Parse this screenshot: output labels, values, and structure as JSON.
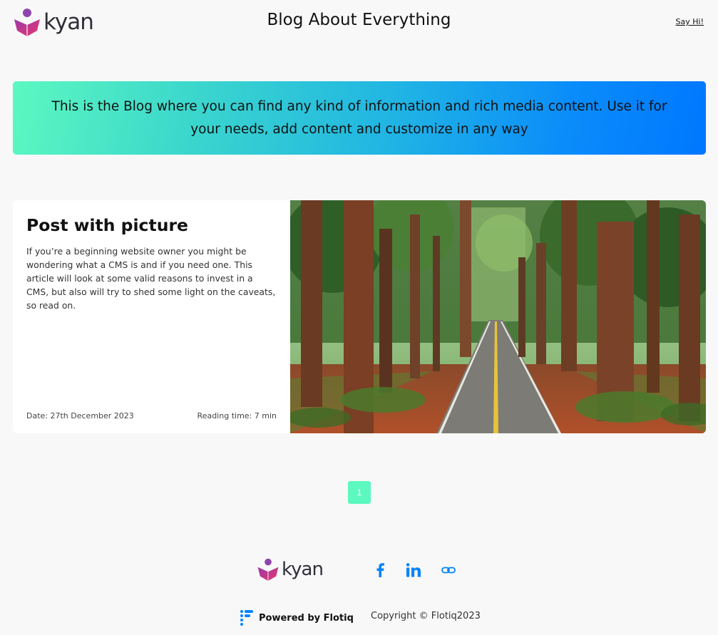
{
  "header": {
    "logo_text": "kyan",
    "site_title": "Blog About Everything",
    "say_hi_link": "Say Hi!"
  },
  "banner": {
    "text": "This is the Blog where you can find any kind of information and rich media content. Use it for your needs, add content and customize in any way"
  },
  "posts": [
    {
      "title": "Post with picture",
      "excerpt": "If you’re a beginning website owner you might be wondering what a CMS is and if you need one. This article will look at some valid reasons to invest in a CMS, but also will try to shed some light on the caveats, so read on.",
      "date": "Date: 27th December 2023",
      "reading_time": "Reading time: 7 min"
    }
  ],
  "pagination": {
    "current_page": "1"
  },
  "footer": {
    "logo_text": "kyan",
    "social_icons": [
      "facebook-icon",
      "linkedin-icon",
      "link-icon"
    ],
    "powered_by": "Powered by Flotiq",
    "copyright": "Copyright © Flotiq2023"
  },
  "colors": {
    "accent": "#5cf8c0",
    "banner_gradient_start": "#5cf8c0",
    "banner_gradient_end": "#0077ff",
    "social_blue": "#0083fc",
    "logo_purple": "#7b3fa0",
    "logo_pink": "#e0367a"
  }
}
